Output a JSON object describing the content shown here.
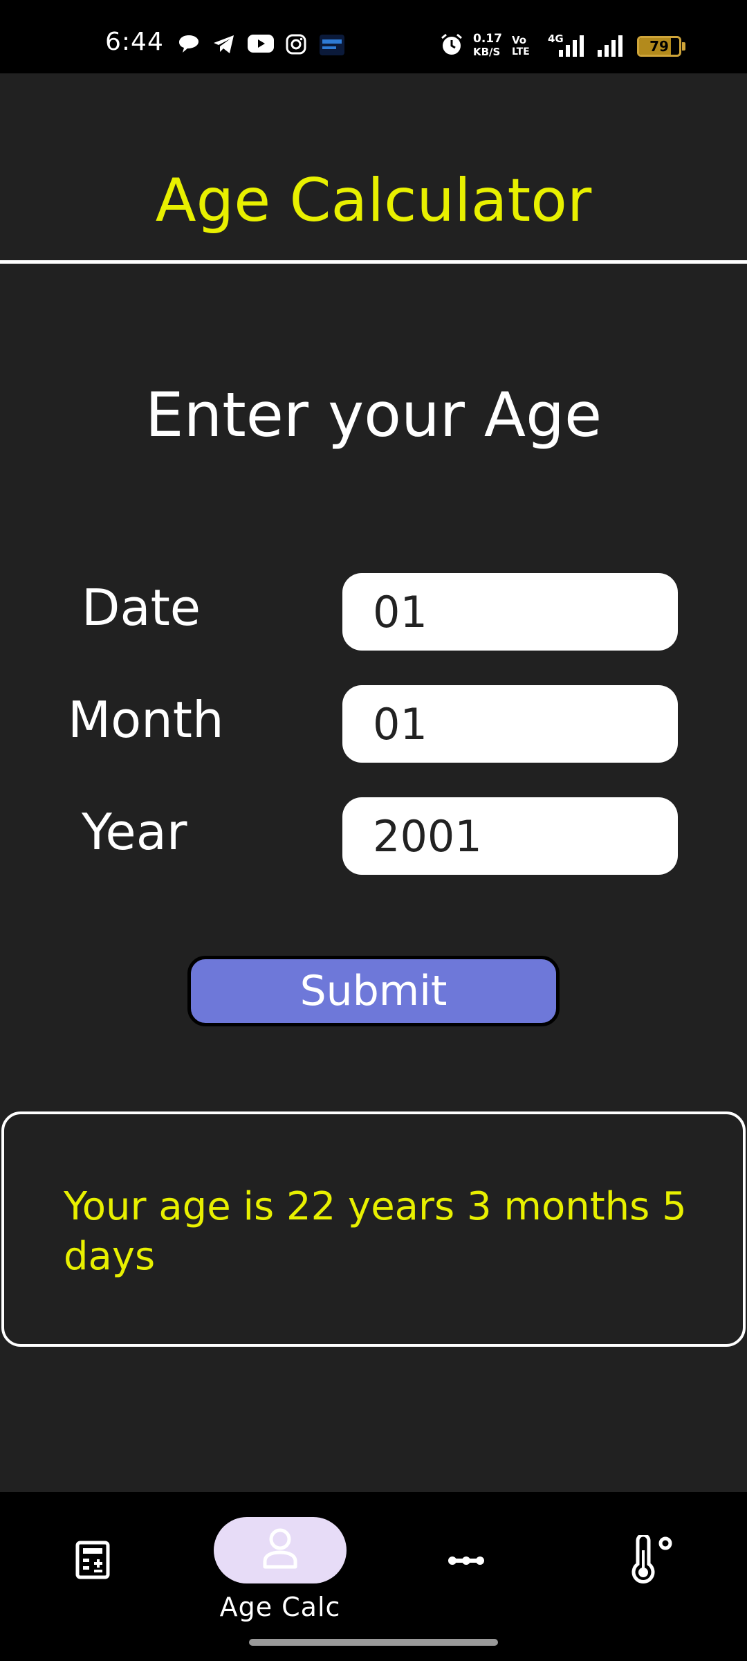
{
  "status_bar": {
    "time": "6:44",
    "net_speed_value": "0.17",
    "net_speed_unit": "KB/S",
    "volte_top": "Vo",
    "volte_bottom": "LTE",
    "network_type": "4G",
    "battery_level": "79",
    "battery_fraction": 0.79
  },
  "header": {
    "title": "Age Calculator"
  },
  "form": {
    "heading": "Enter your Age",
    "date_label": "Date",
    "date_value": "01",
    "month_label": "Month",
    "month_value": "01",
    "year_label": "Year",
    "year_value": "2001",
    "submit_label": "Submit"
  },
  "result": {
    "text": "Your age is 22 years 3 months 5 days"
  },
  "bottom_nav": {
    "items": [
      {
        "icon": "calculator-icon"
      },
      {
        "icon": "person-icon",
        "label": "Age Calc",
        "selected": true
      },
      {
        "icon": "more-dots-icon"
      },
      {
        "icon": "thermometer-icon"
      }
    ]
  },
  "colors": {
    "background": "#212121",
    "accent_yellow": "#e8f000",
    "button": "#6e78d9",
    "nav_pill": "#e7dcf7"
  }
}
